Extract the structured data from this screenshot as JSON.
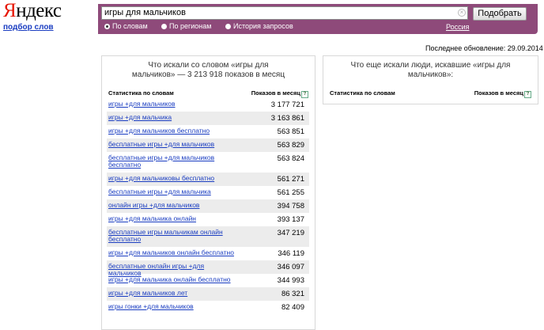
{
  "logo": {
    "y": "Я",
    "rest": "ндекс"
  },
  "sublink": "подбор слов",
  "search": {
    "value": "игры для мальчиков",
    "clear": "×",
    "button": "Подобрать"
  },
  "radios": [
    {
      "label": "По словам",
      "selected": true
    },
    {
      "label": "По регионам",
      "selected": false
    },
    {
      "label": "История запросов",
      "selected": false
    }
  ],
  "region": "Россия",
  "updated": "Последнее обновление: 29.09.2014",
  "left": {
    "title": "Что искали со словом «игры для мальчиков» — 3 213 918 показов в месяц",
    "col_keyword": "Статистика по словам",
    "col_count": "Показов в месяц",
    "rows": [
      {
        "keyword": "игры +для мальчиков",
        "count": "3 177 721"
      },
      {
        "keyword": "игры +для мальчика",
        "count": "3 163 861"
      },
      {
        "keyword": "игры +для мальчиков бесплатно",
        "count": "563 851"
      },
      {
        "keyword": "бесплатные игры +для мальчиков",
        "count": "563 829"
      },
      {
        "keyword": "бесплатные игры +для мальчиков бесплатно",
        "count": "563 824"
      },
      {
        "keyword": "игры +для мальчиковы бесплатно",
        "count": "561 271"
      },
      {
        "keyword": "бесплатные игры +для мальчика",
        "count": "561 255"
      },
      {
        "keyword": "онлайн игры +для мальчиков",
        "count": "394 758"
      },
      {
        "keyword": "игры +для мальчика онлайн",
        "count": "393 137"
      },
      {
        "keyword": "бесплатные игры мальчикам онлайн бесплатно",
        "count": "347 219"
      },
      {
        "keyword": "игры +для мальчиков онлайн бесплатно",
        "count": "346 119"
      },
      {
        "keyword": "бесплатные онлайн игры +для мальчиков",
        "count": "346 097"
      },
      {
        "keyword": "игры +для мальчика онлайн бесплатно",
        "count": "344 993"
      },
      {
        "keyword": "игры +для мальчиков лет",
        "count": "86 321"
      },
      {
        "keyword": "игры гонки +для мальчиков",
        "count": "82 409"
      }
    ]
  },
  "right": {
    "title": "Что еще искали люди, искавшие «игры для мальчиков»:",
    "col_keyword": "Статистика по словам",
    "col_count": "Показов в месяц"
  },
  "colors": {
    "bar": "#8e4a7a",
    "link": "#1a3dc1",
    "logo_red": "#e61400"
  },
  "icons": {
    "clear": "clear-icon",
    "help": "help-icon"
  }
}
